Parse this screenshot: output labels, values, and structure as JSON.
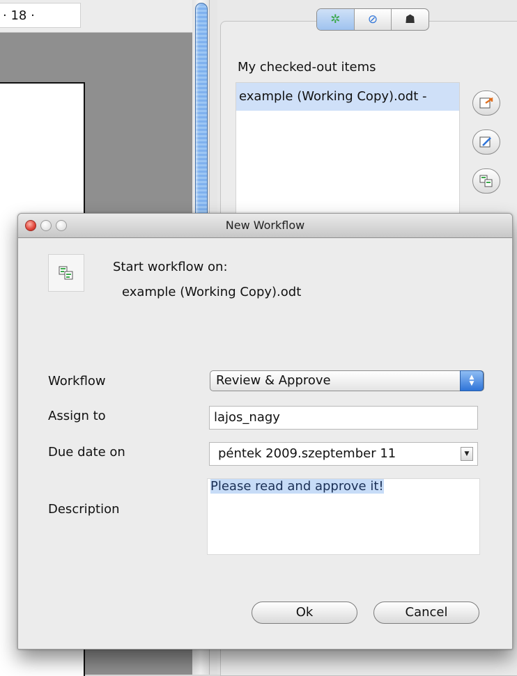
{
  "background_app": {
    "ruler_value": "· 18 ·",
    "side_panel": {
      "tabs": [
        {
          "icon": "spinner-icon",
          "glyph": "✲",
          "active": true
        },
        {
          "icon": "compass-icon",
          "glyph": "⊘",
          "active": false
        },
        {
          "icon": "binoculars-icon",
          "glyph": "☗",
          "active": false
        }
      ],
      "heading": "My checked-out items",
      "items": [
        "example (Working Copy).odt - "
      ],
      "action_icons": [
        "checkin-icon",
        "edit-properties-icon",
        "start-workflow-icon"
      ]
    }
  },
  "dialog": {
    "title": "New Workflow",
    "start_label": "Start workflow on:",
    "file_name": "example (Working Copy).odt",
    "labels": {
      "workflow": "Workflow",
      "assign_to": "Assign to",
      "due_date": "Due date on",
      "description": "Description"
    },
    "workflow_value": "Review & Approve",
    "assign_value": "lajos_nagy",
    "due_value": "péntek 2009.szeptember 11",
    "description_value": "Please read and approve it!",
    "buttons": {
      "ok": "Ok",
      "cancel": "Cancel"
    }
  },
  "colors": {
    "selection": "#cfe0f8",
    "accent_blue": "#2f74d8",
    "close_red": "#e0443a"
  }
}
